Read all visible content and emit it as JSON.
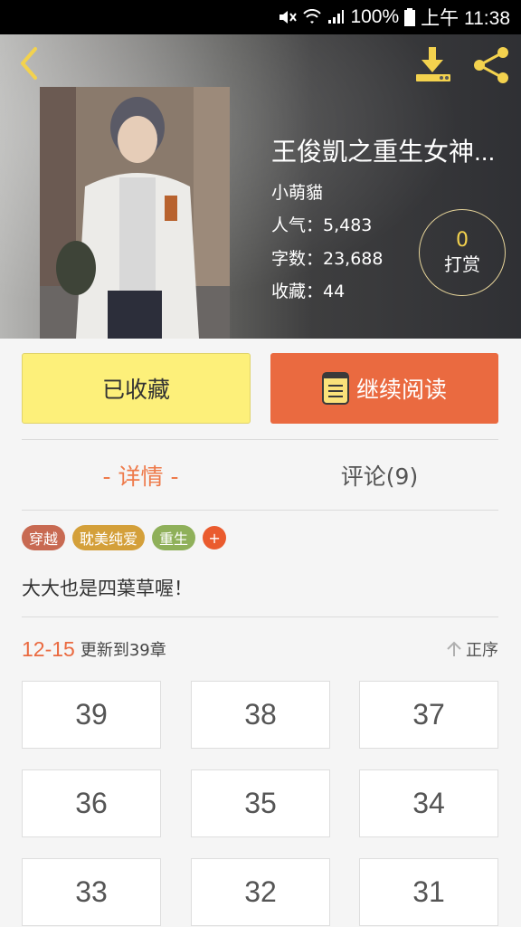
{
  "status_bar": {
    "battery": "100%",
    "time": "上午 11:38"
  },
  "book": {
    "title": "王俊凱之重生女神...",
    "author": "小萌貓",
    "popularity_label": "人气：5,483",
    "word_count_label": "字数：23,688",
    "favorites_label": "收藏：44"
  },
  "tip": {
    "count": "0",
    "label": "打赏"
  },
  "actions": {
    "favorite_label": "已收藏",
    "read_label": "继续阅读"
  },
  "tabs": {
    "details": "- 详情 -",
    "comments": "评论(9)"
  },
  "tags": [
    {
      "label": "穿越",
      "color": "#c86a52"
    },
    {
      "label": "耽美纯爱",
      "color": "#d4a03a"
    },
    {
      "label": "重生",
      "color": "#8fb05a"
    }
  ],
  "tag_add": "+",
  "description": "大大也是四葉草喔！",
  "update": {
    "date": "12-15",
    "info": "更新到39章",
    "sort_label": "正序"
  },
  "chapters": [
    "39",
    "38",
    "37",
    "36",
    "35",
    "34",
    "33",
    "32",
    "31"
  ],
  "colors": {
    "accent": "#ea6a40",
    "favorite_bg": "#fdf07a",
    "header_icon": "#f3d24e"
  }
}
